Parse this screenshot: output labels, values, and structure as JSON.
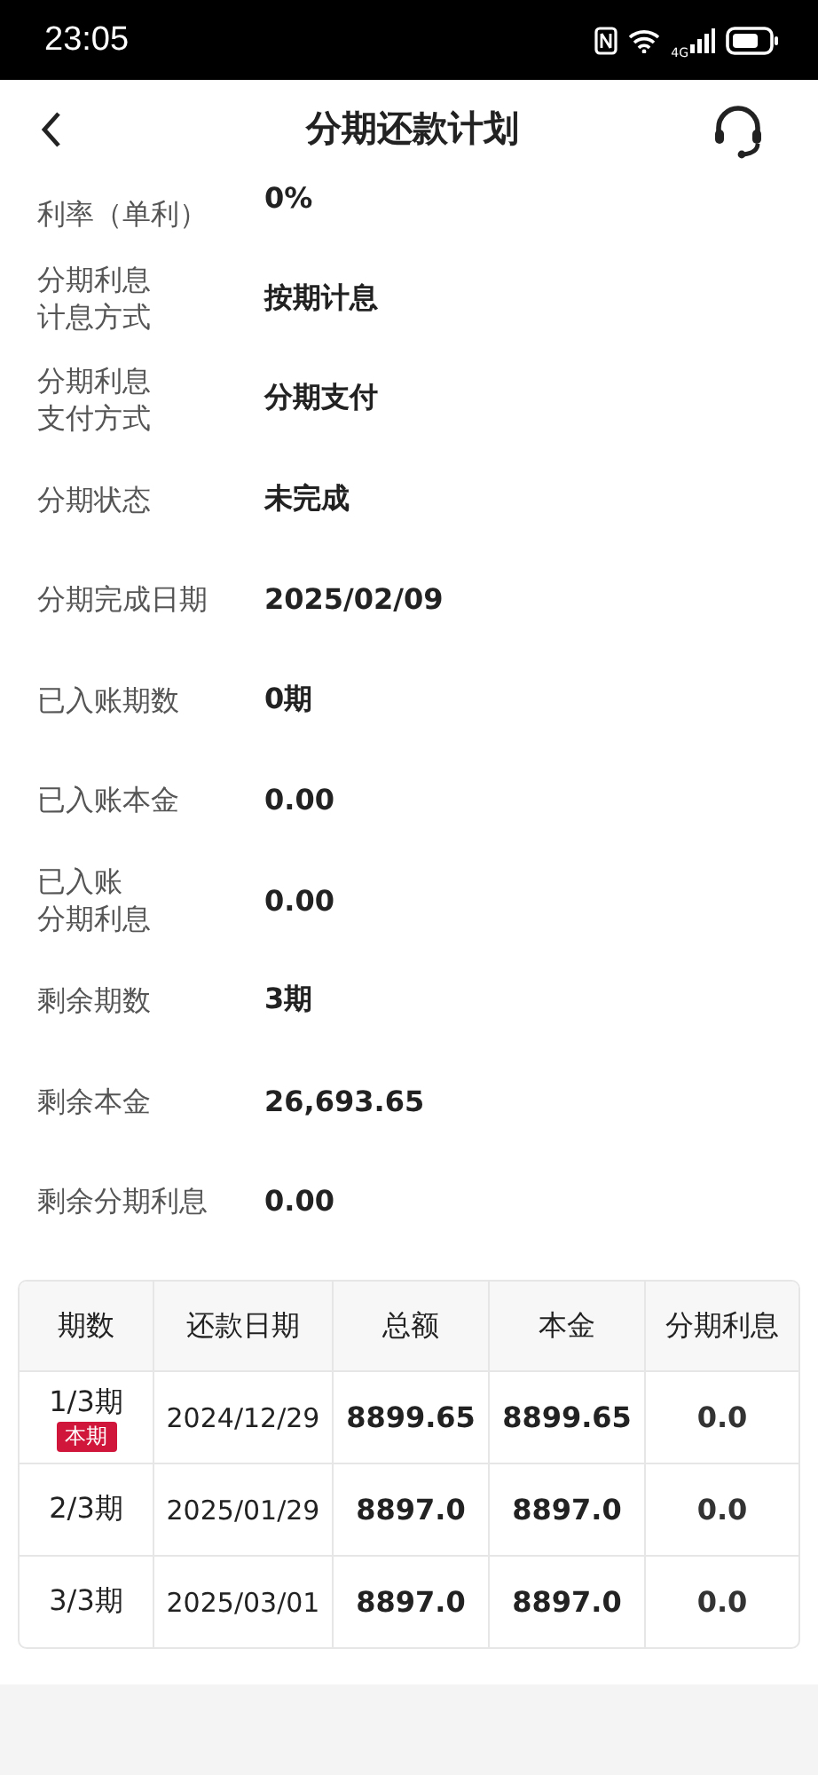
{
  "status_bar": {
    "time": "23:05",
    "network": "4G"
  },
  "header": {
    "title": "分期还款计划"
  },
  "details": [
    {
      "label": [
        "利率（单利）"
      ],
      "value": "0%"
    },
    {
      "label": [
        "分期利息",
        "计息方式"
      ],
      "value": "按期计息"
    },
    {
      "label": [
        "分期利息",
        "支付方式"
      ],
      "value": "分期支付"
    },
    {
      "label": [
        "分期状态"
      ],
      "value": "未完成"
    },
    {
      "label": [
        "分期完成日期"
      ],
      "value": "2025/02/09"
    },
    {
      "label": [
        "已入账期数"
      ],
      "value": "0期"
    },
    {
      "label": [
        "已入账本金"
      ],
      "value": "0.00"
    },
    {
      "label": [
        "已入账",
        "分期利息"
      ],
      "value": "0.00"
    },
    {
      "label": [
        "剩余期数"
      ],
      "value": "3期"
    },
    {
      "label": [
        "剩余本金"
      ],
      "value": "26,693.65"
    },
    {
      "label": [
        "剩余分期利息"
      ],
      "value": "0.00"
    }
  ],
  "table": {
    "columns": [
      "期数",
      "还款日期",
      "总额",
      "本金",
      "分期利息"
    ],
    "rows": [
      {
        "cells": [
          "1/3期",
          "2024/12/29",
          "8899.65",
          "8899.65",
          "0.0"
        ],
        "badge": "本期"
      },
      {
        "cells": [
          "2/3期",
          "2025/01/29",
          "8897.0",
          "8897.0",
          "0.0"
        ]
      },
      {
        "cells": [
          "3/3期",
          "2025/03/01",
          "8897.0",
          "8897.0",
          "0.0"
        ]
      }
    ]
  }
}
